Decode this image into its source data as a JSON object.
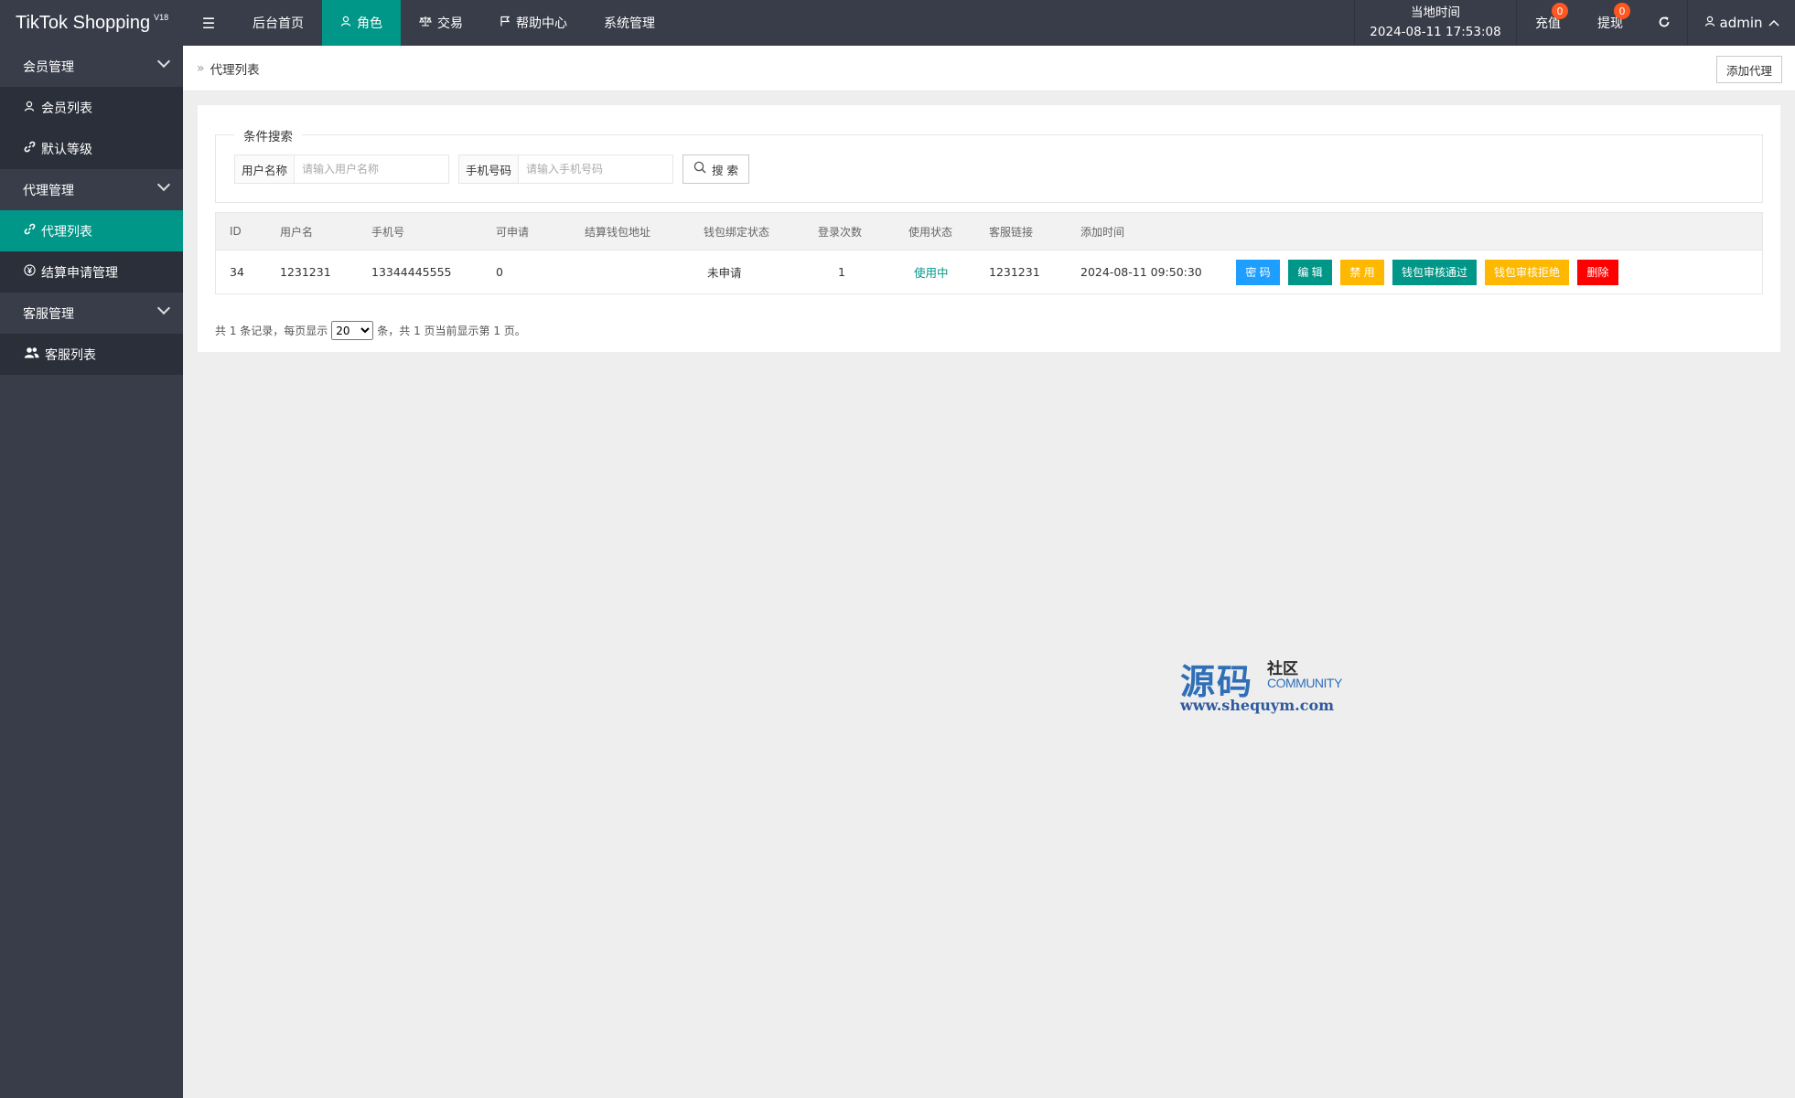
{
  "app": {
    "title": "TikTok Shopping",
    "version": "V18"
  },
  "topnav": {
    "items": [
      {
        "label": "后台首页",
        "icon": "",
        "active": false
      },
      {
        "label": "角色",
        "icon": "user-icon",
        "active": true
      },
      {
        "label": "交易",
        "icon": "balance-scale-icon",
        "active": false
      },
      {
        "label": "帮助中心",
        "icon": "flag-icon",
        "active": false
      },
      {
        "label": "系统管理",
        "icon": "",
        "active": false
      }
    ],
    "menu_toggle_icon": "menu-icon"
  },
  "topright": {
    "clock_label": "当地时间",
    "clock_value": "2024-08-11 17:53:08",
    "recharge_label": "充值",
    "recharge_count": "0",
    "withdraw_label": "提现",
    "withdraw_count": "0",
    "refresh_icon": "refresh-icon",
    "user_name": "admin"
  },
  "sidebar": {
    "groups": [
      {
        "label": "会员管理",
        "items": [
          {
            "label": "会员列表",
            "icon": "user-icon",
            "active": false
          },
          {
            "label": "默认等级",
            "icon": "link-icon",
            "active": false
          }
        ]
      },
      {
        "label": "代理管理",
        "items": [
          {
            "label": "代理列表",
            "icon": "link-icon",
            "active": true
          },
          {
            "label": "结算申请管理",
            "icon": "yen-icon",
            "active": false
          }
        ]
      },
      {
        "label": "客服管理",
        "items": [
          {
            "label": "客服列表",
            "icon": "users-icon",
            "active": false
          }
        ]
      }
    ]
  },
  "breadcrumb": {
    "sep": "»",
    "current": "代理列表"
  },
  "toolbar": {
    "add_label": "添加代理"
  },
  "search": {
    "legend": "条件搜索",
    "username_label": "用户名称",
    "username_placeholder": "请输入用户名称",
    "phone_label": "手机号码",
    "phone_placeholder": "请输入手机号码",
    "button_label": "搜 索"
  },
  "table": {
    "headers": [
      "ID",
      "用户名",
      "手机号",
      "可申请",
      "结算钱包地址",
      "钱包绑定状态",
      "登录次数",
      "使用状态",
      "客服链接",
      "添加时间"
    ],
    "rows": [
      {
        "id": "34",
        "username": "1231231",
        "phone": "13344445555",
        "available": "0",
        "wallet_address": "",
        "wallet_status": "未申请",
        "login_count": "1",
        "use_status": "使用中",
        "service_link": "1231231",
        "added_time": "2024-08-11 09:50:30",
        "actions": [
          "密 码",
          "编 辑",
          "禁 用",
          "钱包审核通过",
          "钱包审核拒绝",
          "删除"
        ]
      }
    ]
  },
  "pager": {
    "prefix": "共 1 条记录，每页显示",
    "page_size": "20",
    "suffix": "条，共 1 页当前显示第 1 页。"
  },
  "watermark": {
    "main": "源码",
    "sub1": "社区",
    "sub2": "COMMUNITY",
    "url": "www.shequym.com"
  },
  "colors": {
    "topbar": "#393d49",
    "accent": "#009688",
    "blue": "#1e9fff",
    "yellow": "#ffb800",
    "red": "#ff0000",
    "badge": "#ff5722"
  }
}
